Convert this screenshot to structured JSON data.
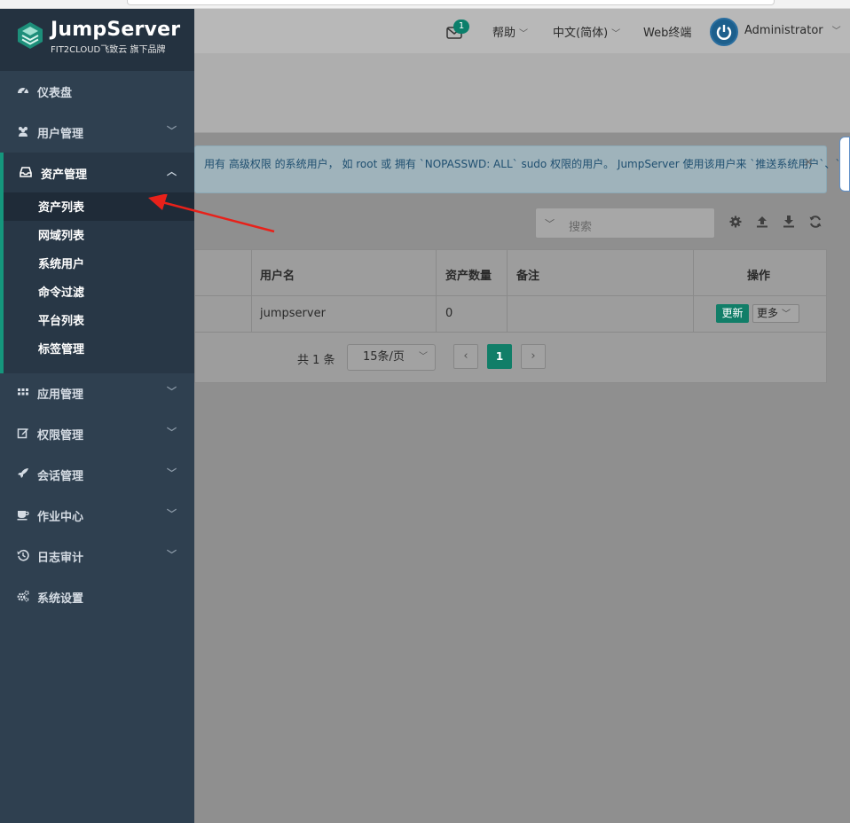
{
  "brand": {
    "title": "JumpServer",
    "subtitle": "FIT2CLOUD飞致云 旗下品牌"
  },
  "header": {
    "mail_count": "1",
    "help": "帮助",
    "language": "中文(简体)",
    "web_terminal": "Web终端",
    "user": "Administrator"
  },
  "sidebar": {
    "items": [
      {
        "label": "仪表盘",
        "icon": "dashboard-icon"
      },
      {
        "label": "用户管理",
        "icon": "users-icon"
      },
      {
        "label": "资产管理",
        "icon": "inbox-icon"
      },
      {
        "label": "应用管理",
        "icon": "grid-icon"
      },
      {
        "label": "权限管理",
        "icon": "edit-icon"
      },
      {
        "label": "会话管理",
        "icon": "rocket-icon"
      },
      {
        "label": "作业中心",
        "icon": "coffee-icon"
      },
      {
        "label": "日志审计",
        "icon": "history-icon"
      },
      {
        "label": "系统设置",
        "icon": "cogs-icon"
      }
    ],
    "asset_sub": [
      {
        "label": "资产列表"
      },
      {
        "label": "网域列表"
      },
      {
        "label": "系统用户"
      },
      {
        "label": "命令过滤"
      },
      {
        "label": "平台列表"
      },
      {
        "label": "标签管理"
      }
    ]
  },
  "alert": {
    "text": "用有 高级权限 的系统用户， 如 root 或 拥有 `NOPASSWD: ALL` sudo 权限的用户。 JumpServer 使用该用户来 `推送系统用户`、`",
    "close": "×"
  },
  "toolbar": {
    "search_placeholder": "搜索"
  },
  "table": {
    "headers": {
      "username": "用户名",
      "asset_count": "资产数量",
      "comment": "备注",
      "actions": "操作"
    },
    "rows": [
      {
        "username": "jumpserver",
        "asset_count": "0",
        "comment": ""
      }
    ],
    "update_btn": "更新",
    "more_btn": "更多"
  },
  "pager": {
    "total": "共 1 条",
    "page_size": "15条/页",
    "current": "1"
  },
  "colors": {
    "sidebar": "#2f4050",
    "accent": "#15967c",
    "arrow": "#e8211a"
  }
}
